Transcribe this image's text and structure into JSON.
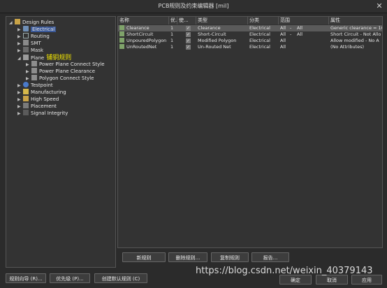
{
  "window": {
    "title": "PCB规则及约束编辑器 [mil]",
    "close_glyph": "✕"
  },
  "tree": {
    "items": [
      {
        "label": "Design Rules",
        "arrow": "◢",
        "icon": "folder-icon"
      },
      {
        "label": "Electrical",
        "arrow": "▶",
        "icon": "electrical-icon",
        "selected": true
      },
      {
        "label": "Routing",
        "arrow": "▶",
        "icon": "routing-icon"
      },
      {
        "label": "SMT",
        "arrow": "▶",
        "icon": "smt-icon"
      },
      {
        "label": "Mask",
        "arrow": "▶",
        "icon": "mask-icon"
      },
      {
        "label": "Plane",
        "arrow": "◢",
        "icon": "plane-icon",
        "annotation": "铺铜规则"
      },
      {
        "label": "Power Plane Connect Style",
        "arrow": "▶",
        "icon": "rule-icon"
      },
      {
        "label": "Power Plane Clearance",
        "arrow": "▶",
        "icon": "rule-icon"
      },
      {
        "label": "Polygon Connect Style",
        "arrow": "▶",
        "icon": "rule-icon"
      },
      {
        "label": "Testpoint",
        "arrow": "▶",
        "icon": "testpoint-icon"
      },
      {
        "label": "Manufacturing",
        "arrow": "▶",
        "icon": "manufacturing-icon"
      },
      {
        "label": "High Speed",
        "arrow": "▶",
        "icon": "highspeed-icon"
      },
      {
        "label": "Placement",
        "arrow": "▶",
        "icon": "placement-icon"
      },
      {
        "label": "Signal Integrity",
        "arrow": "▶",
        "icon": "signal-icon"
      }
    ]
  },
  "table": {
    "headers": [
      "名称",
      "优...",
      "使...",
      "类型",
      "分类",
      "范围",
      "属性"
    ],
    "rows": [
      {
        "name": "Clearance",
        "priority": "1",
        "enabled": "✓",
        "type": "Clearance",
        "category": "Electrical",
        "scope1": "All",
        "dash": "-",
        "scope2": "All",
        "attributes": "Generic clearance = 10"
      },
      {
        "name": "ShortCircuit",
        "priority": "1",
        "enabled": "✓",
        "type": "Short-Circuit",
        "category": "Electrical",
        "scope1": "All",
        "dash": "-",
        "scope2": "All",
        "attributes": "Short Circuit - Not Allo"
      },
      {
        "name": "UnpouredPolygon",
        "priority": "1",
        "enabled": "✓",
        "type": "Modified Polygon",
        "category": "Electrical",
        "scope1": "All",
        "dash": "",
        "scope2": "",
        "attributes": "Allow modified - No A"
      },
      {
        "name": "UnRoutedNet",
        "priority": "1",
        "enabled": "✓",
        "type": "Un-Routed Net",
        "category": "Electrical",
        "scope1": "All",
        "dash": "",
        "scope2": "",
        "attributes": "(No Attributes)"
      }
    ]
  },
  "actions": {
    "new_rule": "新规则",
    "delete_rule": "删除规则...",
    "copy_rule": "复制规则",
    "report": "报告..."
  },
  "footer": {
    "wizard": "规则向导 (R)...",
    "priority": "优先级 (P)...",
    "create_default": "创建默认规则 (C)",
    "ok": "确定",
    "cancel": "取消",
    "apply": "应用"
  },
  "watermark": "https://blog.csdn.net/weixin_40379143",
  "colors": {
    "selection": "#3b5998",
    "annotation": "#f3e600",
    "background": "#2b2b2b"
  }
}
